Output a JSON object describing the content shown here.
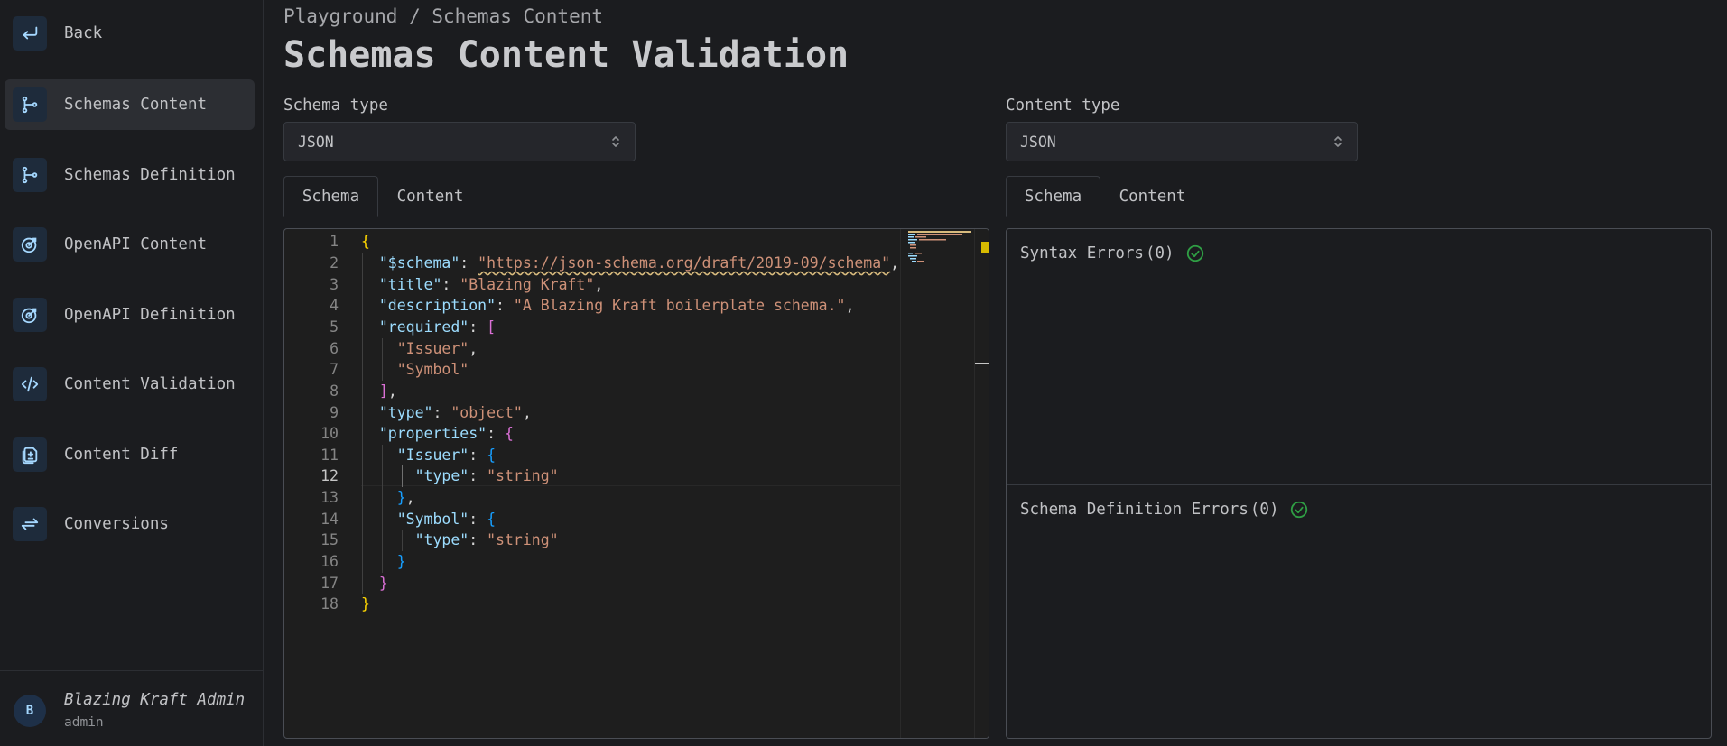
{
  "sidebar": {
    "back_label": "Back",
    "items": [
      {
        "label": "Schemas Content",
        "icon": "schema-tree-icon",
        "active": true
      },
      {
        "label": "Schemas Definition",
        "icon": "schema-tree-icon"
      },
      {
        "label": "OpenAPI Content",
        "icon": "openapi-target-icon"
      },
      {
        "label": "OpenAPI Definition",
        "icon": "openapi-target-icon"
      },
      {
        "label": "Content Validation",
        "icon": "code-icon"
      },
      {
        "label": "Content Diff",
        "icon": "file-diff-icon"
      },
      {
        "label": "Conversions",
        "icon": "arrows-exchange-icon"
      }
    ],
    "user": {
      "initial": "B",
      "name": "Blazing Kraft Admin",
      "role": "admin"
    }
  },
  "header": {
    "breadcrumb": "Playground / Schemas Content",
    "title": "Schemas Content Validation"
  },
  "left": {
    "schema_type_label": "Schema type",
    "schema_type_value": "JSON",
    "tabs": [
      "Schema",
      "Content"
    ],
    "active_tab": "Schema"
  },
  "right": {
    "content_type_label": "Content type",
    "content_type_value": "JSON",
    "tabs": [
      "Schema",
      "Content"
    ],
    "active_tab": "Schema",
    "syntax_errors_label": "Syntax Errors",
    "syntax_errors_count": "(0)",
    "schema_definition_errors_label": "Schema Definition Errors",
    "schema_definition_errors_count": "(0)"
  },
  "editor": {
    "line_numbers": [
      "1",
      "2",
      "3",
      "4",
      "5",
      "6",
      "7",
      "8",
      "9",
      "10",
      "11",
      "12",
      "13",
      "14",
      "15",
      "16",
      "17",
      "18"
    ],
    "current_line": "12",
    "code": {
      "schema_key": "\"$schema\"",
      "schema_value": "\"https://json-schema.org/draft/2019-09/schema\"",
      "title_key": "\"title\"",
      "title_value": "\"Blazing Kraft\"",
      "description_key": "\"description\"",
      "description_value": "\"A Blazing Kraft boilerplate schema.\"",
      "required_key": "\"required\"",
      "required_issuer": "\"Issuer\"",
      "required_symbol": "\"Symbol\"",
      "type_key": "\"type\"",
      "type_value": "\"object\"",
      "properties_key": "\"properties\"",
      "issuer_key": "\"Issuer\"",
      "issuer_type_key": "\"type\"",
      "issuer_type_value": "\"string\"",
      "symbol_key": "\"Symbol\"",
      "symbol_type_key": "\"type\"",
      "symbol_type_value": "\"string\""
    }
  },
  "colors": {
    "background": "#1b1c1f",
    "success": "#2f9e44",
    "icon_blue": "#74c0fc"
  }
}
